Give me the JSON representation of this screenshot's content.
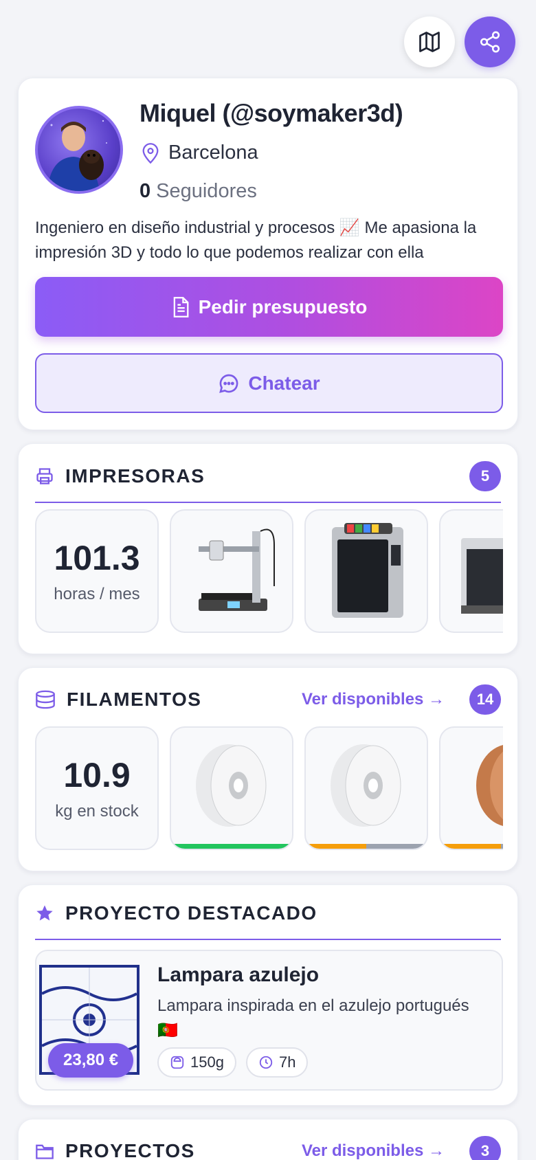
{
  "colors": {
    "accent": "#7c5ce8",
    "gradient_start": "#8b5cf6",
    "gradient_end": "#dc45c6",
    "green": "#22c55e",
    "orange": "#f59e0b",
    "gray": "#9ca3af"
  },
  "icons": {
    "map": "map-icon",
    "share": "share-icon",
    "location": "map-pin-icon",
    "document": "document-icon",
    "chat": "chat-bubble-icon",
    "printer": "printer-icon",
    "filament": "spool-icon",
    "star": "star-icon",
    "folder": "folder-icon",
    "weight": "weight-icon",
    "clock": "clock-icon"
  },
  "profile": {
    "name": "Miquel (@soymaker3d)",
    "location": "Barcelona",
    "followers_count": "0",
    "followers_label": "Seguidores",
    "bio": "Ingeniero en diseño industrial y procesos 📈  Me apasiona la impresión 3D y todo lo que podemos realizar con ella",
    "quote_button": "Pedir presupuesto",
    "chat_button": "Chatear"
  },
  "printers": {
    "title": "IMPRESORAS",
    "count": "5",
    "stat_value": "101.3",
    "stat_unit": "horas / mes"
  },
  "filaments": {
    "title": "FILAMENTOS",
    "link": "Ver disponibles →",
    "count": "14",
    "stat_value": "10.9",
    "stat_unit": "kg en stock",
    "spools": [
      {
        "color": "white",
        "level": 1.0
      },
      {
        "color": "white",
        "level": 0.5
      },
      {
        "color": "copper",
        "level": 0.5
      }
    ]
  },
  "featured": {
    "title": "PROYECTO DESTACADO",
    "project_title": "Lampara azulejo",
    "project_desc": "Lampara inspirada en el azulejo portugués 🇵🇹",
    "price": "23,80 €",
    "weight": "150g",
    "time": "7h"
  },
  "projects": {
    "title": "PROYECTOS",
    "link": "Ver disponibles →",
    "count": "3"
  }
}
